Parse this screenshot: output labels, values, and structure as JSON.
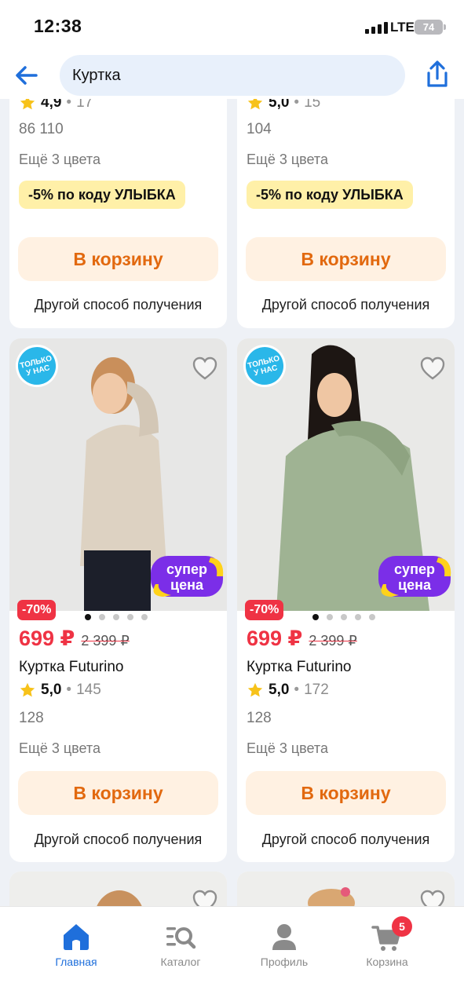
{
  "status": {
    "time": "12:38",
    "network": "LTE",
    "battery": "74"
  },
  "header": {
    "search_value": "Куртка"
  },
  "colors": {
    "accent_blue": "#1f6fdb",
    "price_red": "#ef3344",
    "cart_orange": "#e2690f",
    "promo_yellow": "#fff0a8"
  },
  "top_cards": [
    {
      "rating": "4,9",
      "reviews": "17",
      "sizes": "86  110",
      "more_colors": "Ещё 3 цвета",
      "promo": "-5% по коду  УЛЫБКА",
      "cart_label": "В корзину",
      "alt_label": "Другой способ получения"
    },
    {
      "rating": "5,0",
      "reviews": "15",
      "sizes": "104",
      "more_colors": "Ещё 3 цвета",
      "promo": "-5% по коду  УЛЫБКА",
      "cart_label": "В корзину",
      "alt_label": "Другой способ получения"
    }
  ],
  "product_cards": [
    {
      "badge_line1": "ТОЛЬКО",
      "badge_line2": "У НАС",
      "super_line1": "супер",
      "super_line2": "цена",
      "discount": "-70%",
      "price": "699 ₽",
      "old_price": "2 399 ₽",
      "title": "Куртка Futurino",
      "rating": "5,0",
      "reviews": "145",
      "sizes": "128",
      "more_colors": "Ещё 3 цвета",
      "cart_label": "В корзину",
      "alt_label": "Другой способ получения"
    },
    {
      "badge_line1": "ТОЛЬКО",
      "badge_line2": "У НАС",
      "super_line1": "супер",
      "super_line2": "цена",
      "discount": "-70%",
      "price": "699 ₽",
      "old_price": "2 399 ₽",
      "title": "Куртка Futurino",
      "rating": "5,0",
      "reviews": "172",
      "sizes": "128",
      "more_colors": "Ещё 3 цвета",
      "cart_label": "В корзину",
      "alt_label": "Другой способ получения"
    }
  ],
  "tabbar": {
    "items": [
      {
        "label": "Главная",
        "icon": "home-icon"
      },
      {
        "label": "Каталог",
        "icon": "catalog-search-icon"
      },
      {
        "label": "Профиль",
        "icon": "profile-icon"
      },
      {
        "label": "Корзина",
        "icon": "cart-icon"
      }
    ],
    "cart_count": "5"
  }
}
